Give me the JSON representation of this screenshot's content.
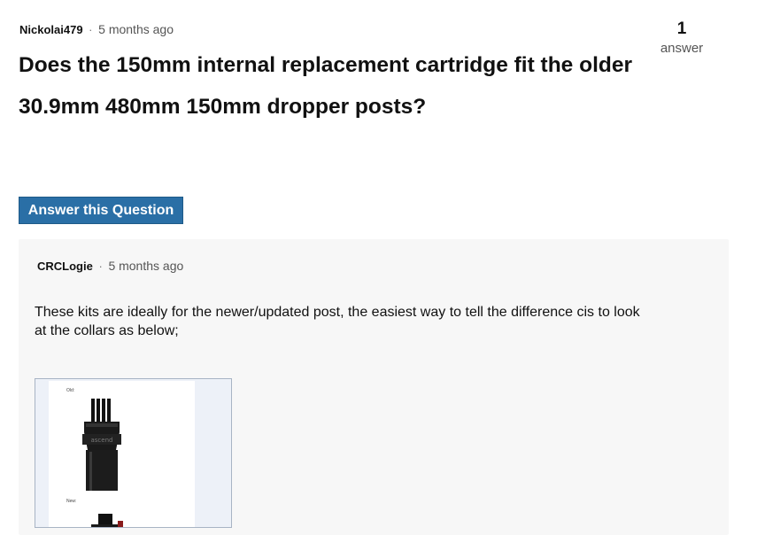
{
  "question": {
    "author": "Nickolai479",
    "separator": "·",
    "time": "5 months ago",
    "title": "Does the 150mm internal replacement cartridge fit the older 30.9mm 480mm 150mm dropper posts?"
  },
  "answer_count": {
    "number": "1",
    "label": "answer"
  },
  "answer_button": {
    "label": "Answer this Question"
  },
  "answer": {
    "author": "CRCLogie",
    "separator": "·",
    "time": "5 months ago",
    "body": "These kits are ideally for the newer/updated post, the easiest way to tell the difference cis to look at the collars as below;",
    "image": {
      "caption_old": "Old:",
      "caption_new": "New:",
      "brand_text": "ascend"
    }
  }
}
